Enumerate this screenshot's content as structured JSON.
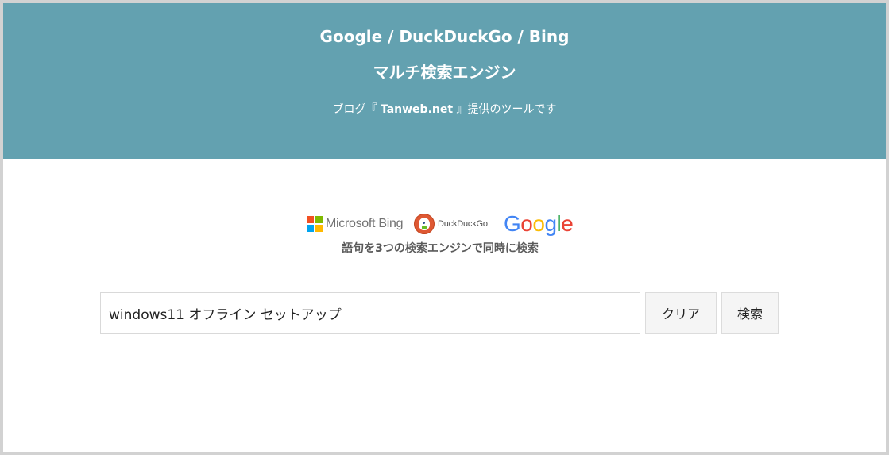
{
  "header": {
    "title_line1": "Google / DuckDuckGo / Bing",
    "title_line2": "マルチ検索エンジン",
    "subtitle_prefix": "ブログ『",
    "subtitle_link": "Tanweb.net",
    "subtitle_suffix": "』提供のツールです",
    "background_color": "#63a1b0"
  },
  "logos": {
    "microsoft_text": "Microsoft Bing",
    "duckduckgo_text": "DuckDuckGo",
    "google_letters": [
      {
        "char": "G",
        "color": "#4285f4"
      },
      {
        "char": "o",
        "color": "#ea4335"
      },
      {
        "char": "o",
        "color": "#fbbc05"
      },
      {
        "char": "g",
        "color": "#4285f4"
      },
      {
        "char": "l",
        "color": "#34a853"
      },
      {
        "char": "e",
        "color": "#ea4335"
      }
    ],
    "caption": "語句を3つの検索エンジンで同時に検索",
    "microsoft_colors": [
      "#f25022",
      "#7fba00",
      "#00a4ef",
      "#ffb900"
    ]
  },
  "search": {
    "value": "windows11 オフライン セットアップ",
    "clear_label": "クリア",
    "search_label": "検索"
  }
}
